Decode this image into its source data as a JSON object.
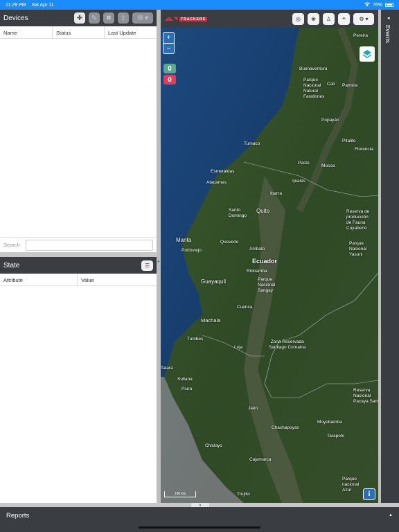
{
  "status_bar": {
    "time": "11:29 PM",
    "date": "Sat Apr 11",
    "battery": "76%"
  },
  "devices": {
    "title": "Devices",
    "columns": [
      "Name",
      "Status",
      "Last Update"
    ],
    "search_label": "Search",
    "search_value": ""
  },
  "state": {
    "title": "State",
    "columns": [
      "Attribute",
      "Value"
    ]
  },
  "map": {
    "logo_text": "TRACKERS",
    "zoom_in": "+",
    "zoom_out": "−",
    "online_count": "0",
    "offline_count": "0",
    "scale_text": "100 km",
    "info_label": "i",
    "labels": {
      "pereira": "Pereira",
      "buenaventura": "Buenaventura",
      "cali": "Cali",
      "palmira": "Palmira",
      "farallones": "Parque\nNacional\nNatural\nFarallones",
      "popayan": "Popayán",
      "pitalito": "Pitalito",
      "florencia": "Florencia",
      "tumaco": "Tumaco",
      "esmeraldas": "Esmeraldas",
      "atacames": "Atacames",
      "pasto": "Pasto",
      "mocoa": "Mocoa",
      "ipiales": "Ipiales",
      "ibarra": "Ibarra",
      "santo_domingo": "Santo\nDomingo",
      "quito": "Quito",
      "reserva_cuyabeno": "Reserva de\nproducción\nde Fauna\nCuyabeno",
      "manta": "Manta",
      "portoviejo": "Portoviejo",
      "quevedo": "Quevedo",
      "ambato": "Ambato",
      "ecuador": "Ecuador",
      "yasuni": "Parque\nNacional\nYasuni",
      "riobamba": "Riobamba",
      "sangay": "Parque\nNacional\nSangay",
      "guayaquil": "Guayaquil",
      "cuenca": "Cuenca",
      "machala": "Machala",
      "tumbes": "Tumbes",
      "loja": "Loja",
      "cordillera": "Zona Reservada\nSantiago Comaina",
      "talara": "Talara",
      "sullana": "Sullana",
      "piura": "Piura",
      "pacaya": "Reserva\nNacional\nPacaya Sam",
      "jaen": "Jaén",
      "moyobamba": "Moyobamba",
      "chachapoyas": "Chachapoyas",
      "tarapoto": "Tarapoto",
      "chiclayo": "Chiclayo",
      "cajamarca": "Cajamarca",
      "trujillo": "Trujillo",
      "azul": "Parque\nnacional\nAzul"
    }
  },
  "events": {
    "label": "Events"
  },
  "reports": {
    "label": "Reports"
  },
  "colors": {
    "panel_dark": "#3a3d42",
    "status_bar": "#1a8cff",
    "online": "#5aa891",
    "offline": "#d9405d",
    "map_control": "#2e6db0"
  }
}
